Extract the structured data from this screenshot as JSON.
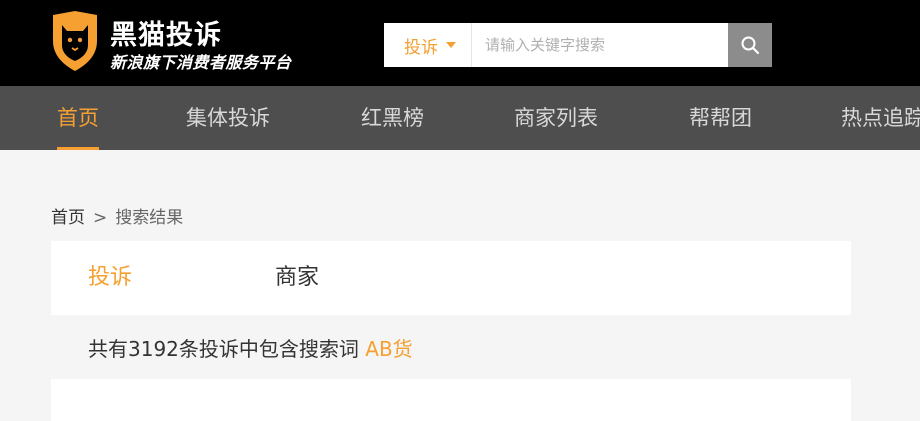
{
  "brand": {
    "title": "黑猫投诉",
    "subtitle": "新浪旗下消费者服务平台"
  },
  "search": {
    "type_label": "投诉",
    "placeholder": "请输入关键字搜索"
  },
  "nav": {
    "items": [
      {
        "label": "首页",
        "active": true
      },
      {
        "label": "集体投诉",
        "active": false
      },
      {
        "label": "红黑榜",
        "active": false
      },
      {
        "label": "商家列表",
        "active": false
      },
      {
        "label": "帮帮团",
        "active": false
      },
      {
        "label": "热点追踪",
        "active": false
      }
    ]
  },
  "breadcrumb": {
    "home": "首页",
    "separator": ">",
    "current": "搜索结果"
  },
  "tabs": {
    "complaints": "投诉",
    "merchants": "商家"
  },
  "result": {
    "prefix": "共有",
    "count": "3192",
    "middle": "条投诉中包含搜索词",
    "keyword": "AB货"
  },
  "colors": {
    "accent": "#f5a031",
    "header_bg": "#000000",
    "nav_bg": "#4e4e4e",
    "page_bg": "#f5f5f5"
  }
}
